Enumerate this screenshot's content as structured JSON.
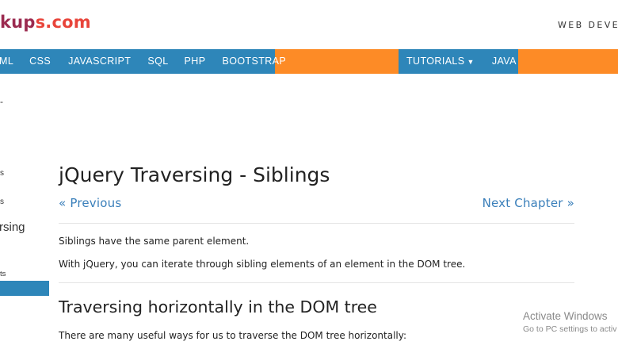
{
  "header": {
    "logo_part1": "kup",
    "logo_part2": "s.com",
    "tagline": "WEB DEVEL"
  },
  "navbar": {
    "left_items": [
      "ML",
      "CSS",
      "JAVASCRIPT",
      "SQL",
      "PHP",
      "BOOTSTRAP"
    ],
    "tutorials_label": "TUTORIALS",
    "java_label": "JAVA",
    "colors": {
      "bar": "#fd8b26",
      "group": "#2e86b9"
    }
  },
  "sidebar": {
    "items": [
      "-",
      "s",
      "s",
      "rsing",
      "ts"
    ],
    "active_color": "#2e86b9"
  },
  "article": {
    "title": "jQuery Traversing - Siblings",
    "prev_label": "« Previous",
    "next_label": "Next Chapter »",
    "para1": "Siblings have the same parent element.",
    "para2": "With jQuery, you can iterate through sibling elements of an element in the DOM tree.",
    "subheading": "Traversing horizontally in the DOM tree",
    "para3": "There are many useful ways for us to traverse the DOM tree horizontally:"
  },
  "watermark": {
    "title": "Activate Windows",
    "subtitle": "Go to PC settings to activ"
  }
}
